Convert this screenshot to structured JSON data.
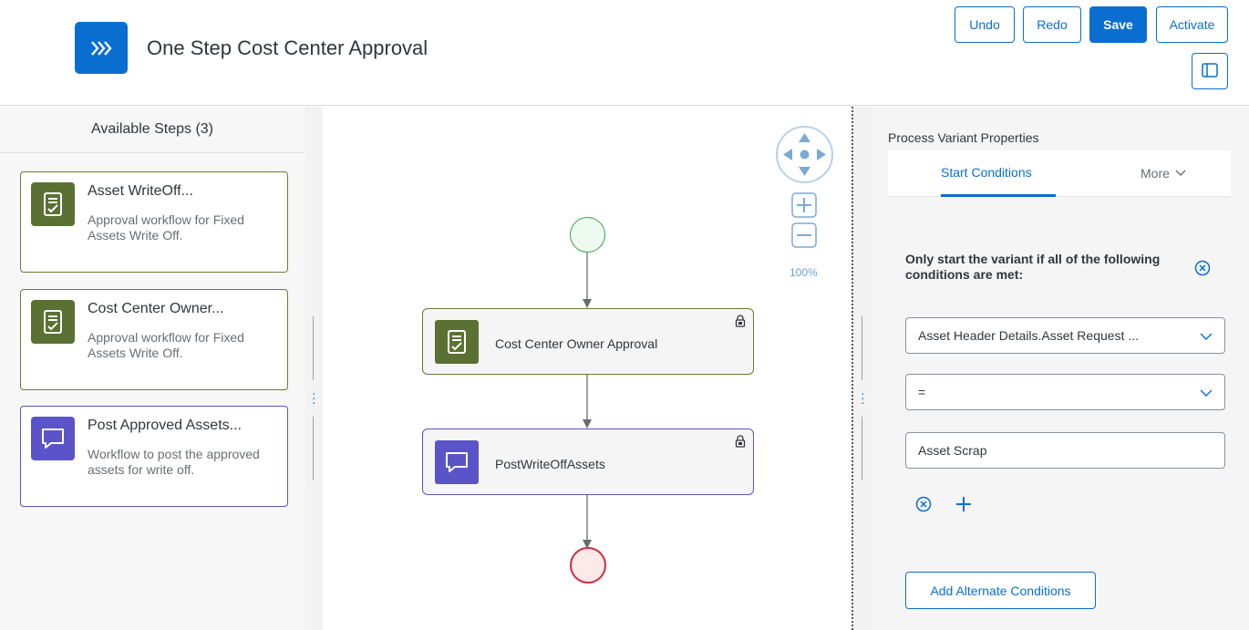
{
  "header": {
    "title": "One Step Cost Center Approval",
    "app_icon": "chevrons-right-icon",
    "buttons": {
      "undo": "Undo",
      "redo": "Redo",
      "save": "Save",
      "activate": "Activate"
    }
  },
  "left_pane": {
    "title": "Available Steps (3)",
    "steps": [
      {
        "title": "Asset WriteOff...",
        "description": "Approval workflow for Fixed Assets Write Off.",
        "icon": "approval-task-icon",
        "color": "#5b7033"
      },
      {
        "title": "Cost Center Owner...",
        "description": "Approval workflow for Fixed Assets Write Off.",
        "icon": "approval-task-icon",
        "color": "#5b7033"
      },
      {
        "title": "Post Approved Assets...",
        "description": "Workflow to post the approved assets for write off.",
        "icon": "comment-icon",
        "color": "#5b54c8"
      }
    ]
  },
  "canvas": {
    "zoom": "100%",
    "nodes": [
      {
        "label": "Cost Center Owner Approval",
        "icon": "approval-task-icon",
        "locked": true
      },
      {
        "label": "PostWriteOffAssets",
        "icon": "comment-icon",
        "locked": true
      }
    ]
  },
  "right_pane": {
    "title": "Process Variant Properties",
    "tabs": {
      "start": "Start Conditions",
      "more": "More"
    },
    "condition_text": "Only start the variant if all of the following conditions are met:",
    "field_select": "Asset Header Details.Asset Request ...",
    "operator": "=",
    "value": "Asset Scrap",
    "alt_button": "Add Alternate Conditions"
  },
  "colors": {
    "accent": "#0a6ed1",
    "green": "#5b7033",
    "purple": "#5b54c8",
    "end": "#cf2c3a",
    "start": "#3aa24d"
  }
}
